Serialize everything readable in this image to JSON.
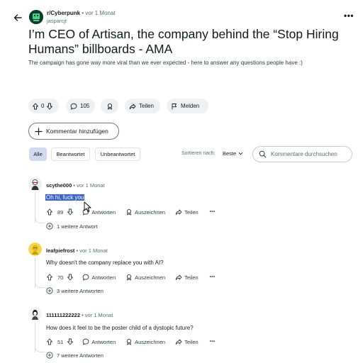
{
  "header": {
    "subreddit": "r/Cyberpunk",
    "separator": "•",
    "time_ago": "vor 1 Monat",
    "author": "jasparcjt",
    "more_label": "•••"
  },
  "post": {
    "title": "I’m CEO of Artisan, the company behind the “Stop Hiring Humans” billboards - AMA",
    "body": "The campaign has gone way more viral than we ever expected - here to answer any questions people have :)",
    "vote_count": "0",
    "comment_count": "105",
    "share_label": "Teilen",
    "report_label": "Melden"
  },
  "add_comment_label": "Kommentar hinzufügen",
  "filters": {
    "all": "Alle",
    "answered": "Beantwortet",
    "unanswered": "Unbeantwortet",
    "sort_label": "Sortieren nach:",
    "sort_value": "Beste",
    "search_placeholder": "Kommentare durchsuchen"
  },
  "comment_actions": {
    "reply": "Antworten",
    "award": "Auszeichnen",
    "share": "Teilen",
    "more": "•••"
  },
  "comments": [
    {
      "author": "scythe000",
      "meta": "• vor 1 Monat",
      "text": "Oh hi, fuck you",
      "votes": "89",
      "replies": "1 weitere Antwort"
    },
    {
      "author": "leafpiefrost",
      "meta": "• vor 1 Monat",
      "text": "Why doesn't the company replace you with AI?",
      "votes": "70",
      "replies": "3 weitere Antworten"
    },
    {
      "author": "111111222222",
      "meta": "• vor 1 Monat",
      "text": "How does it feel to be the poster child of a dystopic future?",
      "votes": "51",
      "replies": "7 weitere Antworten"
    }
  ],
  "colors": {
    "selection": "#3c63c7",
    "pill_bg": "#eef1f3",
    "active_filter": "#cfd9f0"
  }
}
